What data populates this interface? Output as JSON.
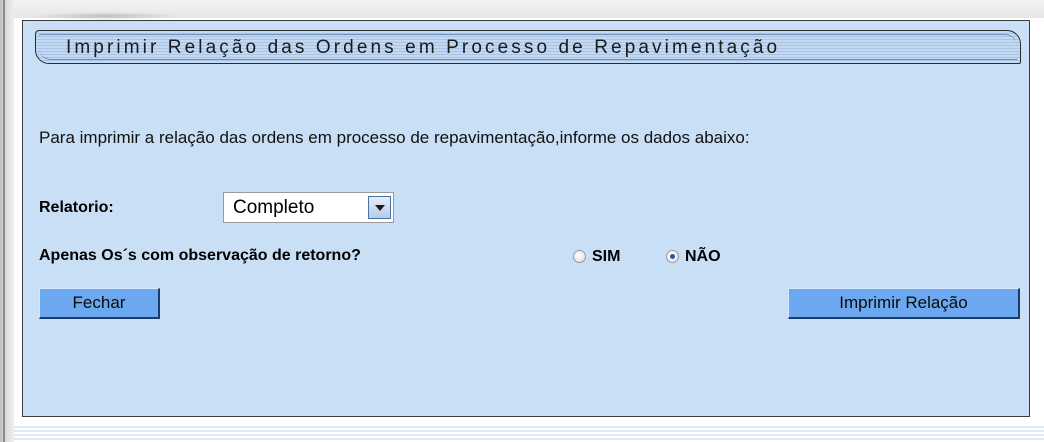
{
  "panel": {
    "title": "Imprimir Relação das Ordens em Processo de Repavimentação",
    "intro": "Para imprimir a relação das ordens em processo de repavimentação,informe os dados abaixo:"
  },
  "relatorio": {
    "label": "Relatorio:",
    "selected": "Completo"
  },
  "observacao": {
    "label": "Apenas Os´s com observação de retorno?",
    "options": [
      {
        "label": "SIM",
        "checked": false
      },
      {
        "label": "NÃO",
        "checked": true
      }
    ]
  },
  "buttons": {
    "close": "Fechar",
    "print": "Imprimir Relação"
  },
  "colors": {
    "panel_background": "#c9dff6",
    "button_background": "#6ba8f0"
  }
}
